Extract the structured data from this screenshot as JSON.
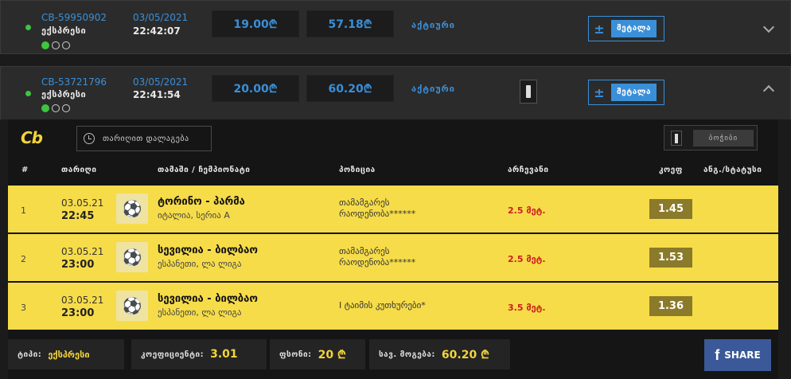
{
  "bets": [
    {
      "id": "CB-59950902",
      "type": "ექსპრესი",
      "date": "03/05/2021",
      "time": "22:42:07",
      "stake": "19.00₾",
      "payout": "57.18₾",
      "status": "აქტიური",
      "calc_label": "მეტალა",
      "calc_symbol": "±"
    },
    {
      "id": "CB-53721796",
      "type": "ექსპრესი",
      "date": "03/05/2021",
      "time": "22:41:54",
      "stake": "20.00₾",
      "payout": "60.20₾",
      "status": "აქტიური",
      "calc_label": "მეტალა",
      "calc_symbol": "±"
    }
  ],
  "panel": {
    "logo": "Cb",
    "date_filter": "თარიღით დალაგება",
    "print_label": "ბოჭიბი",
    "columns": {
      "num": "#",
      "date": "თარიღი",
      "match": "თამაში / ჩემპიონატი",
      "pick": "პოზიცია",
      "result": "არჩევანი",
      "odds": "კოეფ",
      "stats": "ანგ./სტატუსი"
    },
    "rows": [
      {
        "num": "1",
        "date": "03.05.21",
        "time": "22:45",
        "match": "ტორინო - პარმა",
        "league": "იტალია, სერია A",
        "pick_1": "თამამგარეს",
        "pick_2": "რაოდენობა******",
        "result": "2.5 მეტ.",
        "odds": "1.45"
      },
      {
        "num": "2",
        "date": "03.05.21",
        "time": "23:00",
        "match": "სევილია - ბილბაო",
        "league": "ესპანეთი, ლა ლიგა",
        "pick_1": "თამამგარეს",
        "pick_2": "რაოდენობა******",
        "result": "2.5 მეტ.",
        "odds": "1.53"
      },
      {
        "num": "3",
        "date": "03.05.21",
        "time": "23:00",
        "match": "სევილია - ბილბაო",
        "league": "ესპანეთი, ლა ლიგა",
        "pick_1": "I ტაიმის კუთხურები*",
        "pick_2": "",
        "result": "3.5 მეტ.",
        "odds": "1.36"
      }
    ],
    "footer": {
      "type_label": "ტიპი:",
      "type_value": "ექსპრესი",
      "coef_label": "კოეფიციენტი:",
      "coef_value": "3.01",
      "stake_label": "ფსონი:",
      "stake_value": "20 ₾",
      "win_label": "სავ. მოგება:",
      "win_value": "60.20 ₾",
      "share_label": "SHARE",
      "share_icon": "f"
    }
  },
  "colors": {
    "accent": "#3a8fd9",
    "yellow": "#f6dc49",
    "odds_bg": "#8a7a2a",
    "facebook": "#3b5998"
  }
}
